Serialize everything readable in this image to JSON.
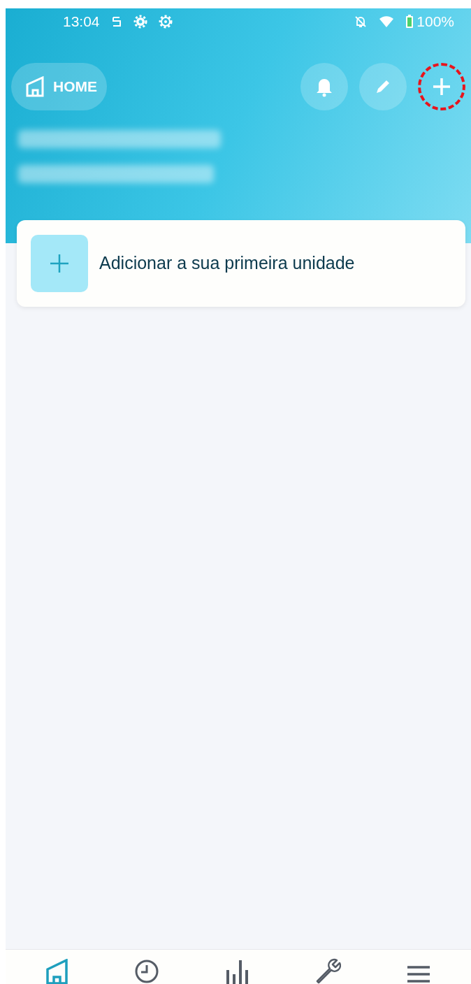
{
  "status_bar": {
    "time": "13:04",
    "battery": "100%"
  },
  "header": {
    "home_label": "HOME",
    "actions": [
      {
        "kind": "bell",
        "highlighted": false
      },
      {
        "kind": "pencil",
        "highlighted": false
      },
      {
        "kind": "plus",
        "highlighted": true
      }
    ]
  },
  "add_card": {
    "label": "Adicionar a sua primeira unidade"
  },
  "bottom_nav": [
    {
      "kind": "home",
      "selected": true
    },
    {
      "kind": "clock",
      "selected": false
    },
    {
      "kind": "chart",
      "selected": false
    },
    {
      "kind": "wrench",
      "selected": false
    },
    {
      "kind": "menu",
      "selected": false
    }
  ]
}
